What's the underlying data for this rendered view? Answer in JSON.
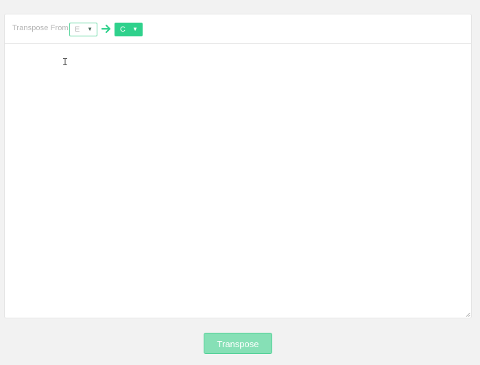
{
  "toolbar": {
    "label": "Transpose From",
    "from_key": {
      "value": "E",
      "icon": "chevron-down-icon"
    },
    "arrow_icon": "arrow-right-icon",
    "to_key": {
      "value": "C",
      "icon": "chevron-down-icon"
    }
  },
  "editor": {
    "content": "",
    "cursor_icon": "text-cursor-icon"
  },
  "actions": {
    "transpose_label": "Transpose"
  },
  "colors": {
    "accent": "#2fd18c",
    "accent_light": "#86e0b6",
    "background": "#f2f2f2"
  }
}
